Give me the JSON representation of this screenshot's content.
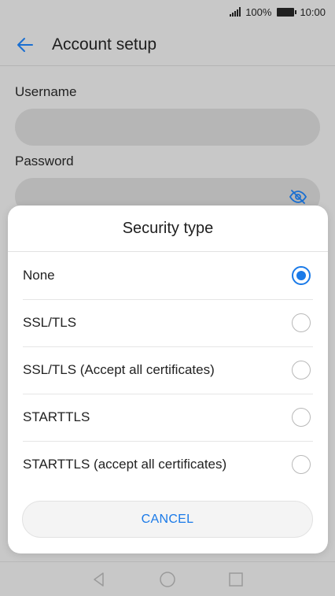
{
  "status_bar": {
    "battery_percent": "100%",
    "time": "10:00"
  },
  "app_bar": {
    "title": "Account setup"
  },
  "form": {
    "username_label": "Username",
    "password_label": "Password",
    "username_value": "",
    "password_value": ""
  },
  "dialog": {
    "title": "Security type",
    "options": [
      {
        "label": "None",
        "selected": true
      },
      {
        "label": "SSL/TLS",
        "selected": false
      },
      {
        "label": "SSL/TLS (Accept all certificates)",
        "selected": false
      },
      {
        "label": "STARTTLS",
        "selected": false
      },
      {
        "label": "STARTTLS (accept all certificates)",
        "selected": false
      }
    ],
    "cancel_label": "CANCEL"
  },
  "colors": {
    "accent": "#1a7ae8"
  },
  "icons": [
    "signal-icon",
    "battery-icon",
    "back-arrow-icon",
    "eye-off-icon",
    "nav-back-icon",
    "nav-home-icon",
    "nav-recents-icon"
  ]
}
